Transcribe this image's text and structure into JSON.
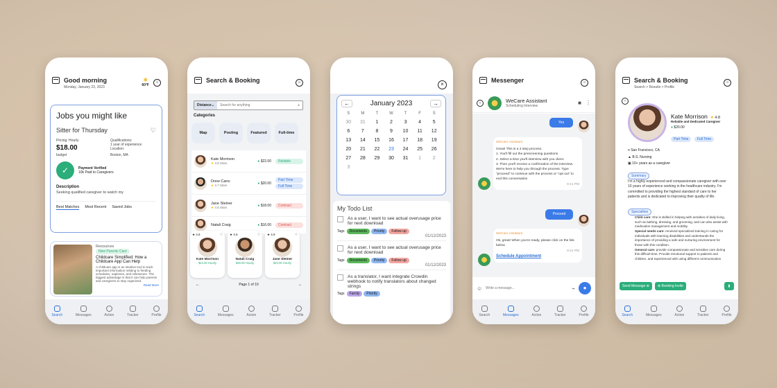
{
  "p1": {
    "title": "Good morning",
    "date": "Monday, January 23, 2023",
    "temp": "60°F",
    "jobs_title": "Jobs you might like",
    "job_title": "Sitter for Thursday",
    "pricing_label": "Pricing: Hourly",
    "price": "$18.00",
    "budget": "budget",
    "qual_label": "Qualifications:",
    "qual_value": "1 year of experience",
    "loc_label": "Location:",
    "loc_value": "Boston, MA",
    "verified": "Payment Verified",
    "paid": "10k Paid to Caregivers",
    "desc_label": "Description",
    "desc_text": "Seeking qualified caregiver to watch my",
    "tabs": [
      "Best Matches",
      "Most Recent",
      "Saved Jobs"
    ],
    "res_label": "Resources",
    "res_badge": "New Parents Care",
    "res_title": "Childcare Simplified: How a Childcare App Can Help",
    "res_body": "A childcare app is an intuitive tool to track important information relating to feeding schedules, naptimes, and milestones. The biggest advantage is that it can help parents and caregivers to stay organized.",
    "read_more": "Read More"
  },
  "nav": [
    "Search",
    "Messages",
    "Action",
    "Tracker",
    "Profile"
  ],
  "p2": {
    "title": "Search & Booking",
    "distance": "Distance",
    "search_ph": "Search for anything",
    "categories": "Categories",
    "cats": [
      "Map",
      "Posting",
      "Featured",
      "Full-time"
    ],
    "list": [
      {
        "name": "Kate Morrison",
        "stars": "4.8 Stars",
        "price": "$22.00",
        "tags": [
          "Reliable"
        ]
      },
      {
        "name": "Drew Cano",
        "stars": "4.7 Stars",
        "price": "$20.00",
        "tags": [
          "Part Time",
          "Full Time"
        ]
      },
      {
        "name": "Jane Steiner",
        "stars": "4.6 Stars",
        "price": "$18.00",
        "tags": [
          "Contract"
        ]
      },
      {
        "name": "Natali Craig",
        "stars": "",
        "price": "$16.00",
        "tags": [
          "Contract"
        ]
      }
    ],
    "cards": [
      {
        "r": "4.8",
        "name": "Kate Morrison",
        "price": "$24.00 Hourly"
      },
      {
        "r": "4.6",
        "name": "Natali Craig",
        "price": "$30.00 Hourly"
      },
      {
        "r": "4.9",
        "name": "Jane Steiner",
        "price": "$23.00 Hourly"
      }
    ],
    "page": "Page 1 of 10"
  },
  "p3": {
    "month": "January 2023",
    "dow": [
      "S",
      "M",
      "T",
      "W",
      "T",
      "F",
      "S"
    ],
    "days": [
      "30",
      "31",
      "1",
      "2",
      "3",
      "4",
      "5",
      "6",
      "7",
      "8",
      "9",
      "10",
      "11",
      "12",
      "13",
      "14",
      "15",
      "16",
      "17",
      "18",
      "19",
      "20",
      "21",
      "22",
      "23",
      "24",
      "25",
      "26",
      "27",
      "28",
      "29",
      "30",
      "31",
      "1",
      "2",
      "3"
    ],
    "todo_title": "My Todo List",
    "todos": [
      {
        "text": "As a user, I want to see actual overusage price for next download",
        "tags": [
          "Documents",
          "Priority",
          "Follow up"
        ],
        "date": "01/12/2023"
      },
      {
        "text": "As a user, I want to see actual overusage price for next download",
        "tags": [
          "Documents",
          "Priority",
          "Follow up"
        ],
        "date": "01/12/2023"
      },
      {
        "text": "As a translator, I want integrate Crowdin webhook to notify translators about changed strings",
        "tags": [
          "Family",
          "Priority"
        ],
        "date": ""
      }
    ],
    "tags_label": "Tags"
  },
  "p4": {
    "title": "Messenger",
    "contact": "WeCare Assistant",
    "status": "Scheduling Interview",
    "yes": "Yes",
    "assistant": "WeCare Assistant",
    "msg1": [
      "Great! This is a 3 step process.",
      "1. You'll fill out the prescreening questions",
      "2. Select a time you'll interview with you client.",
      "3. Then you'll receive a confirmation of the interview.",
      "We're here to help you through the process. Type \"proceed\" to continue with the process or \"opt out\" to end this conversation"
    ],
    "time1": "9:41 PM",
    "proceed": "Proceed",
    "msg2": "Ok, great! When you're ready, please click on the link below.",
    "time2": "9:41 PM",
    "link": "Schedule Appointment",
    "input_ph": "Write a message..."
  },
  "p5": {
    "title": "Search & Booking",
    "crumb": "Search > Results > Profile",
    "name": "Kate Morrison",
    "rating": "4.8",
    "subtitle": "Reliable and Dedicated Caregiver",
    "rate": "$20.00",
    "tags": [
      "Part Time",
      "Full Time"
    ],
    "loc": "San Francisco, CA",
    "edu": "B.S. Nursing",
    "exp": "10+ years as a caregiver",
    "summary_label": "Summary",
    "summary": "I'm a highly experienced and compassionate caregiver with over 10 years of experience working in the healthcare industry. I'm committed to providing the highest standard of care to her patients and is dedicated to improving their quality of life.",
    "spec_label": "Specialties",
    "specs": [
      {
        "k": "Child care:",
        "v": "She is skilled in helping with activities of daily living, such as bathing, dressing, and grooming, and can also assist with medication management and mobility."
      },
      {
        "k": "Special needs care:",
        "v": "received specialized training in caring for individuals with learning disabilities and understands the importance of providing a safe and nurturing environment for those with this condition."
      },
      {
        "k": "General care:",
        "v": "provide compassionate and sensitive care during this difficult time. Provide emotional support to patients and children, and experienced with using different communication techniques to"
      }
    ],
    "send": "Send Message",
    "invite": "Booking Invite"
  },
  "colors": {
    "accent": "#2a6fd6",
    "green": "#2bae7a"
  }
}
